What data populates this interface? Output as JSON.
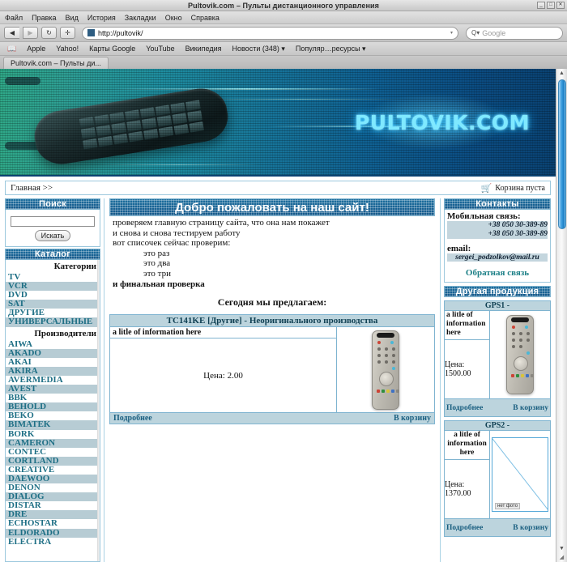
{
  "window": {
    "title": "Pultovik.com – Пульты дистанционного управления",
    "minimize": "_",
    "maximize": "□",
    "close": "✕"
  },
  "menubar": [
    "Файл",
    "Правка",
    "Вид",
    "История",
    "Закладки",
    "Окно",
    "Справка"
  ],
  "nav": {
    "back_icon": "◀",
    "forward_icon": "▶",
    "reload_icon": "↻",
    "add_icon": "✛",
    "url": "http://pultovik/",
    "url_arrow": "▾",
    "search_icon": "Q▾",
    "search_placeholder": "Google"
  },
  "bookmarks": {
    "book_icon": "📖",
    "items": [
      "Apple",
      "Yahoo!",
      "Карты Google",
      "YouTube",
      "Википедия",
      "Новости (348) ▾",
      "Популяр…ресурсы ▾"
    ]
  },
  "tab": {
    "label": "Pultovik.com – Пульты ди..."
  },
  "banner": {
    "logo": "PULTOVIK.COM"
  },
  "crumbbar": {
    "breadcrumb": "Главная >>",
    "cart_icon": "🛒",
    "cart_text": "Корзина пуста"
  },
  "left": {
    "search": {
      "header": "Поиск",
      "value": "",
      "placeholder": "",
      "button": "Искать"
    },
    "catalog": {
      "header": "Каталог",
      "categories_label": "Категории",
      "categories": [
        "TV",
        "VCR",
        "DVD",
        "SAT",
        "ДРУГИЕ",
        "УНИВЕРСАЛЬНЫЕ"
      ],
      "manufacturers_label": "Производители",
      "manufacturers": [
        "AIWA",
        "AKADO",
        "AKAI",
        "AKIRA",
        "AVERMEDIA",
        "AVEST",
        "BBK",
        "BEHOLD",
        "BEKO",
        "BIMATEK",
        "BORK",
        "CAMERON",
        "CONTEC",
        "CORTLAND",
        "CREATIVE",
        "DAEWOO",
        "DENON",
        "DIALOG",
        "DISTAR",
        "DRE",
        "ECHOSTAR",
        "ELDORADO",
        "ELECTRA"
      ]
    }
  },
  "main": {
    "title": "Добро пожаловать на наш сайт!",
    "lines": [
      "проверяем главную страницу сайта, что она нам покажет",
      "и снова и снова тестируем работу",
      "вот списочек сейчас проверим:"
    ],
    "list": [
      "это раз",
      "это два",
      "это три"
    ],
    "final_line": "и финальная проверка",
    "offer_heading": "Сегодня мы предлагаем:",
    "product": {
      "title": "TC141KE [Другие] - Неоригинального производства",
      "info": "a litle of information here",
      "price": "Цена: 2.00",
      "more_label": "Подробнее",
      "buy_label": "В корзину"
    }
  },
  "right": {
    "contacts": {
      "header": "Контакты",
      "mobile_label": "Мобильная связь:",
      "phones": [
        "+38 050 30-389-89",
        "+38 050 30-389-89"
      ],
      "email_label": "email:",
      "email": "sergei_podzolkov@mail.ru",
      "feedback": "Обратная связь"
    },
    "other_products": {
      "header": "Другая продукция",
      "items": [
        {
          "title": "GPS1 -",
          "info": "a litle of information here",
          "price": "Цена: 1500.00",
          "more_label": "Подробнее",
          "buy_label": "В корзину",
          "photo": "remote"
        },
        {
          "title": "GPS2 -",
          "info": "a litle of information here",
          "price": "Цена: 1370.00",
          "more_label": "Подробнее",
          "buy_label": "В корзину",
          "photo": "missing",
          "photo_alt": "нет фото"
        }
      ]
    }
  },
  "scrollbar": {
    "up": "▲",
    "down": "▼",
    "grip": "◢"
  }
}
